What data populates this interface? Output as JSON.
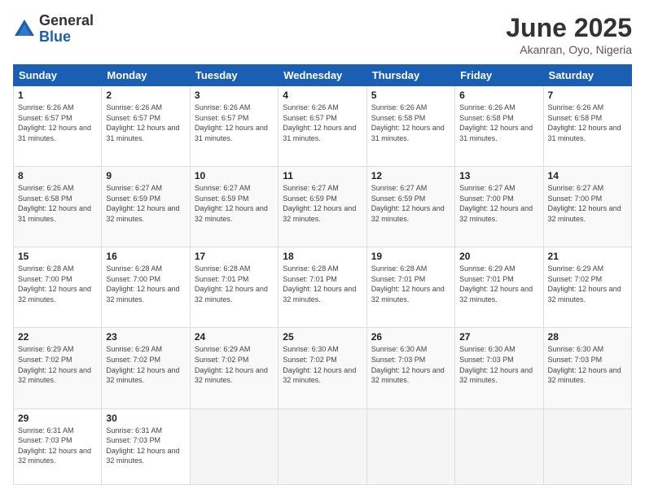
{
  "logo": {
    "general": "General",
    "blue": "Blue"
  },
  "title": "June 2025",
  "location": "Akanran, Oyo, Nigeria",
  "headers": [
    "Sunday",
    "Monday",
    "Tuesday",
    "Wednesday",
    "Thursday",
    "Friday",
    "Saturday"
  ],
  "rows": [
    [
      {
        "day": "1",
        "sunrise": "6:26 AM",
        "sunset": "6:57 PM",
        "daylight": "12 hours and 31 minutes."
      },
      {
        "day": "2",
        "sunrise": "6:26 AM",
        "sunset": "6:57 PM",
        "daylight": "12 hours and 31 minutes."
      },
      {
        "day": "3",
        "sunrise": "6:26 AM",
        "sunset": "6:57 PM",
        "daylight": "12 hours and 31 minutes."
      },
      {
        "day": "4",
        "sunrise": "6:26 AM",
        "sunset": "6:57 PM",
        "daylight": "12 hours and 31 minutes."
      },
      {
        "day": "5",
        "sunrise": "6:26 AM",
        "sunset": "6:58 PM",
        "daylight": "12 hours and 31 minutes."
      },
      {
        "day": "6",
        "sunrise": "6:26 AM",
        "sunset": "6:58 PM",
        "daylight": "12 hours and 31 minutes."
      },
      {
        "day": "7",
        "sunrise": "6:26 AM",
        "sunset": "6:58 PM",
        "daylight": "12 hours and 31 minutes."
      }
    ],
    [
      {
        "day": "8",
        "sunrise": "6:26 AM",
        "sunset": "6:58 PM",
        "daylight": "12 hours and 31 minutes."
      },
      {
        "day": "9",
        "sunrise": "6:27 AM",
        "sunset": "6:59 PM",
        "daylight": "12 hours and 32 minutes."
      },
      {
        "day": "10",
        "sunrise": "6:27 AM",
        "sunset": "6:59 PM",
        "daylight": "12 hours and 32 minutes."
      },
      {
        "day": "11",
        "sunrise": "6:27 AM",
        "sunset": "6:59 PM",
        "daylight": "12 hours and 32 minutes."
      },
      {
        "day": "12",
        "sunrise": "6:27 AM",
        "sunset": "6:59 PM",
        "daylight": "12 hours and 32 minutes."
      },
      {
        "day": "13",
        "sunrise": "6:27 AM",
        "sunset": "7:00 PM",
        "daylight": "12 hours and 32 minutes."
      },
      {
        "day": "14",
        "sunrise": "6:27 AM",
        "sunset": "7:00 PM",
        "daylight": "12 hours and 32 minutes."
      }
    ],
    [
      {
        "day": "15",
        "sunrise": "6:28 AM",
        "sunset": "7:00 PM",
        "daylight": "12 hours and 32 minutes."
      },
      {
        "day": "16",
        "sunrise": "6:28 AM",
        "sunset": "7:00 PM",
        "daylight": "12 hours and 32 minutes."
      },
      {
        "day": "17",
        "sunrise": "6:28 AM",
        "sunset": "7:01 PM",
        "daylight": "12 hours and 32 minutes."
      },
      {
        "day": "18",
        "sunrise": "6:28 AM",
        "sunset": "7:01 PM",
        "daylight": "12 hours and 32 minutes."
      },
      {
        "day": "19",
        "sunrise": "6:28 AM",
        "sunset": "7:01 PM",
        "daylight": "12 hours and 32 minutes."
      },
      {
        "day": "20",
        "sunrise": "6:29 AM",
        "sunset": "7:01 PM",
        "daylight": "12 hours and 32 minutes."
      },
      {
        "day": "21",
        "sunrise": "6:29 AM",
        "sunset": "7:02 PM",
        "daylight": "12 hours and 32 minutes."
      }
    ],
    [
      {
        "day": "22",
        "sunrise": "6:29 AM",
        "sunset": "7:02 PM",
        "daylight": "12 hours and 32 minutes."
      },
      {
        "day": "23",
        "sunrise": "6:29 AM",
        "sunset": "7:02 PM",
        "daylight": "12 hours and 32 minutes."
      },
      {
        "day": "24",
        "sunrise": "6:29 AM",
        "sunset": "7:02 PM",
        "daylight": "12 hours and 32 minutes."
      },
      {
        "day": "25",
        "sunrise": "6:30 AM",
        "sunset": "7:02 PM",
        "daylight": "12 hours and 32 minutes."
      },
      {
        "day": "26",
        "sunrise": "6:30 AM",
        "sunset": "7:03 PM",
        "daylight": "12 hours and 32 minutes."
      },
      {
        "day": "27",
        "sunrise": "6:30 AM",
        "sunset": "7:03 PM",
        "daylight": "12 hours and 32 minutes."
      },
      {
        "day": "28",
        "sunrise": "6:30 AM",
        "sunset": "7:03 PM",
        "daylight": "12 hours and 32 minutes."
      }
    ],
    [
      {
        "day": "29",
        "sunrise": "6:31 AM",
        "sunset": "7:03 PM",
        "daylight": "12 hours and 32 minutes."
      },
      {
        "day": "30",
        "sunrise": "6:31 AM",
        "sunset": "7:03 PM",
        "daylight": "12 hours and 32 minutes."
      },
      null,
      null,
      null,
      null,
      null
    ]
  ]
}
